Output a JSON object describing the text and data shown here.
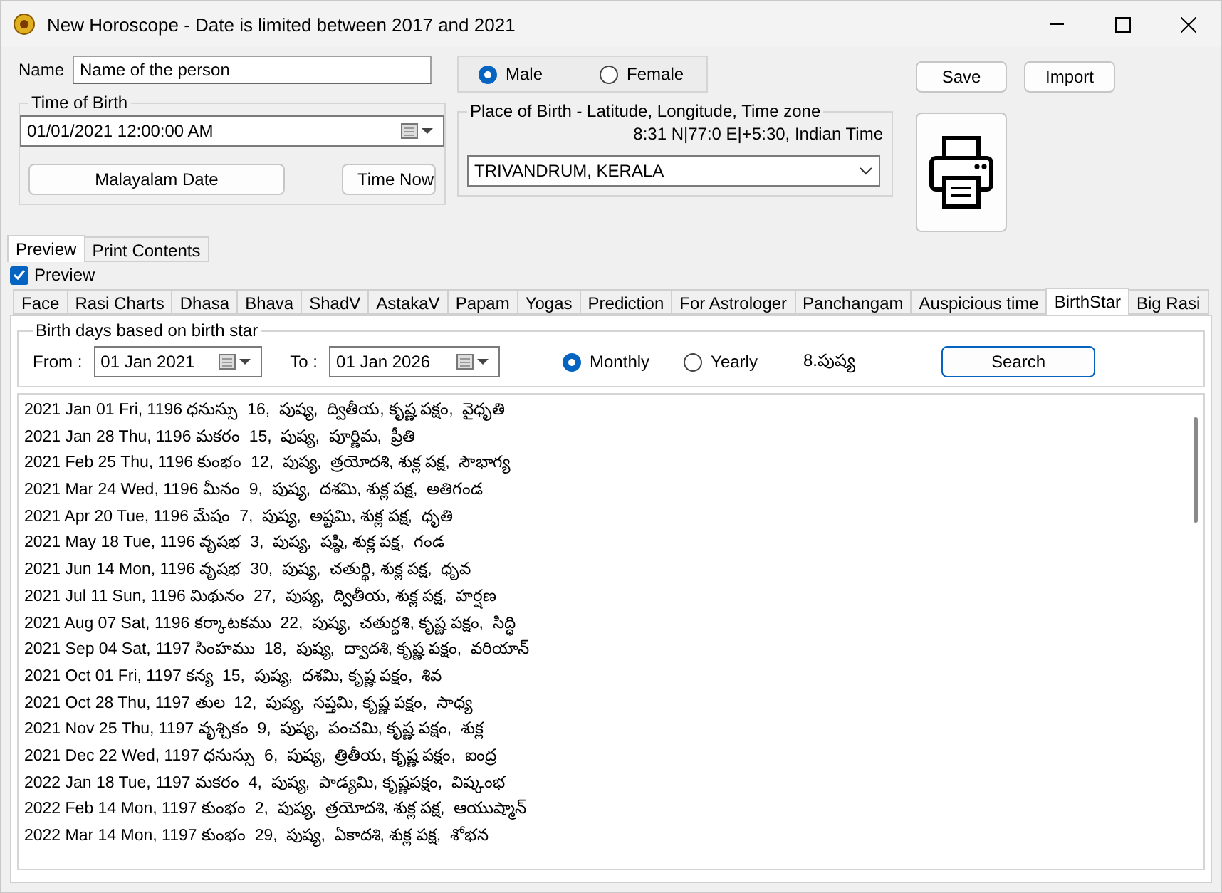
{
  "window": {
    "title": "New Horoscope - Date is limited between 2017 and 2021"
  },
  "name": {
    "label": "Name",
    "value": "Name of the person"
  },
  "gender": [
    {
      "label": "Male",
      "selected": true
    },
    {
      "label": "Female",
      "selected": false
    }
  ],
  "buttons": [
    "Save",
    "Import"
  ],
  "time_of_birth": {
    "title": "Time of Birth",
    "value": "01/01/2021  12:00:00 AM",
    "buttons": [
      "Malayalam Date",
      "Time Now"
    ]
  },
  "place": {
    "title": "Place of Birth - Latitude, Longitude, Time zone",
    "coords": "8:31 N|77:0 E|+5:30, Indian Time",
    "value": "TRIVANDRUM, KERALA"
  },
  "outer_tabs": [
    {
      "label": "Preview",
      "selected": true
    },
    {
      "label": "Print Contents",
      "selected": false
    }
  ],
  "preview_checkbox": {
    "label": "Preview",
    "checked": true
  },
  "tabs": [
    {
      "label": "Face",
      "selected": false
    },
    {
      "label": "Rasi Charts",
      "selected": false
    },
    {
      "label": "Dhasa",
      "selected": false
    },
    {
      "label": "Bhava",
      "selected": false
    },
    {
      "label": "ShadV",
      "selected": false
    },
    {
      "label": "AstakaV",
      "selected": false
    },
    {
      "label": "Papam",
      "selected": false
    },
    {
      "label": "Yogas",
      "selected": false
    },
    {
      "label": "Prediction",
      "selected": false
    },
    {
      "label": "For Astrologer",
      "selected": false
    },
    {
      "label": "Panchangam",
      "selected": false
    },
    {
      "label": "Auspicious time",
      "selected": false
    },
    {
      "label": "BirthStar",
      "selected": true
    },
    {
      "label": "Big Rasi",
      "selected": false
    }
  ],
  "birthstar": {
    "title": "Birth days based on birth star",
    "from_label": "From :",
    "from_value": "01 Jan  2021",
    "to_label": "To :",
    "to_value": "01 Jan  2026",
    "period": [
      {
        "label": "Monthly",
        "selected": true
      },
      {
        "label": "Yearly",
        "selected": false
      }
    ],
    "star": "8.పుష్య",
    "search": "Search"
  },
  "results": [
    "2021 Jan 01 Fri, 1196 ధనుస్సు  16,  పుష్య,  ద్వితీయ, కృష్ణ పక్షం,  వైధృతి",
    "2021 Jan 28 Thu, 1196 మకరం  15,  పుష్య,  పూర్ణిమ,  ప్రీతి",
    "2021 Feb 25 Thu, 1196 కుంభం  12,  పుష్య,  త్రయోదశి, శుక్ల పక్ష,  సౌభాగ్య",
    "2021 Mar 24 Wed, 1196 మీనం  9,  పుష్య,  దశమి, శుక్ల పక్ష,  అతిగండ",
    "2021 Apr 20 Tue, 1196 మేషం  7,  పుష్య,  అష్టమి, శుక్ల పక్ష,  ధృతి",
    "2021 May 18 Tue, 1196 వృషభ  3,  పుష్య,  షష్ఠి, శుక్ల పక్ష,  గండ",
    "2021 Jun 14 Mon, 1196 వృషభ  30,  పుష్య,  చతుర్థి, శుక్ల పక్ష,  ధృవ",
    "2021 Jul 11 Sun, 1196 మిథునం  27,  పుష్య,  ద్వితీయ, శుక్ల పక్ష,  హర్షణ",
    "2021 Aug 07 Sat, 1196 కర్కాటకము  22,  పుష్య,  చతుర్దశి, కృష్ణ పక్షం,  సిద్ధి",
    "2021 Sep 04 Sat, 1197 సింహము  18,  పుష్య,  ద్వాదశి, కృష్ణ పక్షం,  వరియాన్",
    "2021 Oct 01 Fri, 1197 కన్య  15,  పుష్య,  దశమి, కృష్ణ పక్షం,  శివ",
    "2021 Oct 28 Thu, 1197 తుల  12,  పుష్య,  సప్తమి, కృష్ణ పక్షం,  సాధ్య",
    "2021 Nov 25 Thu, 1197 వృశ్చికం  9,  పుష్య,  పంచమి, కృష్ణ పక్షం,  శుక్ల",
    "2021 Dec 22 Wed, 1197 ధనుస్సు  6,  పుష్య,  త్రితీయ, కృష్ణ పక్షం,  ఐంద్ర",
    "2022 Jan 18 Tue, 1197 మకరం  4,  పుష్య,  పాడ్యమి, కృష్ణపక్షం,  విష్కంభ",
    "2022 Feb 14 Mon, 1197 కుంభం  2,  పుష్య,  త్రయోదశి, శుక్ల పక్ష,  ఆయుష్మాన్",
    "2022 Mar 14 Mon, 1197 కుంభం  29,  పుష్య,  ఏకాదశి, శుక్ల పక్ష,  శోభన"
  ]
}
